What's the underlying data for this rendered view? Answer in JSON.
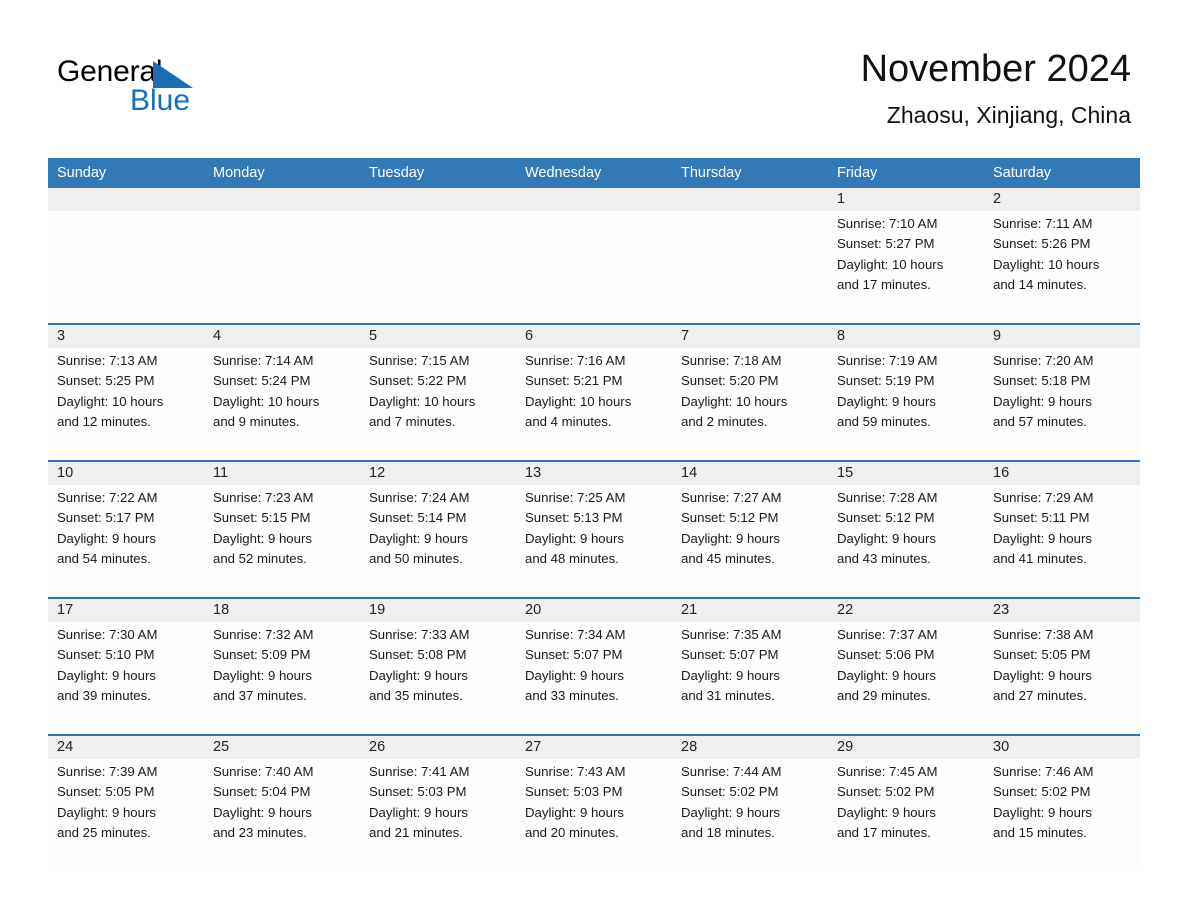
{
  "brand": {
    "name_part1": "General",
    "name_part2": "Blue",
    "triangle_color": "#1b6eb3",
    "blue_text_color": "#1570bd"
  },
  "header": {
    "month_title": "November 2024",
    "location": "Zhaosu, Xinjiang, China"
  },
  "theme": {
    "header_blue": "#3279b8",
    "row_divider_blue": "#2f74b5",
    "date_band_gray": "#efefef",
    "cell_background": "#fdfdfc",
    "page_background": "#ffffff"
  },
  "calendar": {
    "weekday_headers": [
      "Sunday",
      "Monday",
      "Tuesday",
      "Wednesday",
      "Thursday",
      "Friday",
      "Saturday"
    ],
    "weeks": [
      [
        {
          "day": "",
          "sunrise": "",
          "sunset": "",
          "daylight_line1": "",
          "daylight_line2": ""
        },
        {
          "day": "",
          "sunrise": "",
          "sunset": "",
          "daylight_line1": "",
          "daylight_line2": ""
        },
        {
          "day": "",
          "sunrise": "",
          "sunset": "",
          "daylight_line1": "",
          "daylight_line2": ""
        },
        {
          "day": "",
          "sunrise": "",
          "sunset": "",
          "daylight_line1": "",
          "daylight_line2": ""
        },
        {
          "day": "",
          "sunrise": "",
          "sunset": "",
          "daylight_line1": "",
          "daylight_line2": ""
        },
        {
          "day": "1",
          "sunrise": "Sunrise: 7:10 AM",
          "sunset": "Sunset: 5:27 PM",
          "daylight_line1": "Daylight: 10 hours",
          "daylight_line2": "and 17 minutes."
        },
        {
          "day": "2",
          "sunrise": "Sunrise: 7:11 AM",
          "sunset": "Sunset: 5:26 PM",
          "daylight_line1": "Daylight: 10 hours",
          "daylight_line2": "and 14 minutes."
        }
      ],
      [
        {
          "day": "3",
          "sunrise": "Sunrise: 7:13 AM",
          "sunset": "Sunset: 5:25 PM",
          "daylight_line1": "Daylight: 10 hours",
          "daylight_line2": "and 12 minutes."
        },
        {
          "day": "4",
          "sunrise": "Sunrise: 7:14 AM",
          "sunset": "Sunset: 5:24 PM",
          "daylight_line1": "Daylight: 10 hours",
          "daylight_line2": "and 9 minutes."
        },
        {
          "day": "5",
          "sunrise": "Sunrise: 7:15 AM",
          "sunset": "Sunset: 5:22 PM",
          "daylight_line1": "Daylight: 10 hours",
          "daylight_line2": "and 7 minutes."
        },
        {
          "day": "6",
          "sunrise": "Sunrise: 7:16 AM",
          "sunset": "Sunset: 5:21 PM",
          "daylight_line1": "Daylight: 10 hours",
          "daylight_line2": "and 4 minutes."
        },
        {
          "day": "7",
          "sunrise": "Sunrise: 7:18 AM",
          "sunset": "Sunset: 5:20 PM",
          "daylight_line1": "Daylight: 10 hours",
          "daylight_line2": "and 2 minutes."
        },
        {
          "day": "8",
          "sunrise": "Sunrise: 7:19 AM",
          "sunset": "Sunset: 5:19 PM",
          "daylight_line1": "Daylight: 9 hours",
          "daylight_line2": "and 59 minutes."
        },
        {
          "day": "9",
          "sunrise": "Sunrise: 7:20 AM",
          "sunset": "Sunset: 5:18 PM",
          "daylight_line1": "Daylight: 9 hours",
          "daylight_line2": "and 57 minutes."
        }
      ],
      [
        {
          "day": "10",
          "sunrise": "Sunrise: 7:22 AM",
          "sunset": "Sunset: 5:17 PM",
          "daylight_line1": "Daylight: 9 hours",
          "daylight_line2": "and 54 minutes."
        },
        {
          "day": "11",
          "sunrise": "Sunrise: 7:23 AM",
          "sunset": "Sunset: 5:15 PM",
          "daylight_line1": "Daylight: 9 hours",
          "daylight_line2": "and 52 minutes."
        },
        {
          "day": "12",
          "sunrise": "Sunrise: 7:24 AM",
          "sunset": "Sunset: 5:14 PM",
          "daylight_line1": "Daylight: 9 hours",
          "daylight_line2": "and 50 minutes."
        },
        {
          "day": "13",
          "sunrise": "Sunrise: 7:25 AM",
          "sunset": "Sunset: 5:13 PM",
          "daylight_line1": "Daylight: 9 hours",
          "daylight_line2": "and 48 minutes."
        },
        {
          "day": "14",
          "sunrise": "Sunrise: 7:27 AM",
          "sunset": "Sunset: 5:12 PM",
          "daylight_line1": "Daylight: 9 hours",
          "daylight_line2": "and 45 minutes."
        },
        {
          "day": "15",
          "sunrise": "Sunrise: 7:28 AM",
          "sunset": "Sunset: 5:12 PM",
          "daylight_line1": "Daylight: 9 hours",
          "daylight_line2": "and 43 minutes."
        },
        {
          "day": "16",
          "sunrise": "Sunrise: 7:29 AM",
          "sunset": "Sunset: 5:11 PM",
          "daylight_line1": "Daylight: 9 hours",
          "daylight_line2": "and 41 minutes."
        }
      ],
      [
        {
          "day": "17",
          "sunrise": "Sunrise: 7:30 AM",
          "sunset": "Sunset: 5:10 PM",
          "daylight_line1": "Daylight: 9 hours",
          "daylight_line2": "and 39 minutes."
        },
        {
          "day": "18",
          "sunrise": "Sunrise: 7:32 AM",
          "sunset": "Sunset: 5:09 PM",
          "daylight_line1": "Daylight: 9 hours",
          "daylight_line2": "and 37 minutes."
        },
        {
          "day": "19",
          "sunrise": "Sunrise: 7:33 AM",
          "sunset": "Sunset: 5:08 PM",
          "daylight_line1": "Daylight: 9 hours",
          "daylight_line2": "and 35 minutes."
        },
        {
          "day": "20",
          "sunrise": "Sunrise: 7:34 AM",
          "sunset": "Sunset: 5:07 PM",
          "daylight_line1": "Daylight: 9 hours",
          "daylight_line2": "and 33 minutes."
        },
        {
          "day": "21",
          "sunrise": "Sunrise: 7:35 AM",
          "sunset": "Sunset: 5:07 PM",
          "daylight_line1": "Daylight: 9 hours",
          "daylight_line2": "and 31 minutes."
        },
        {
          "day": "22",
          "sunrise": "Sunrise: 7:37 AM",
          "sunset": "Sunset: 5:06 PM",
          "daylight_line1": "Daylight: 9 hours",
          "daylight_line2": "and 29 minutes."
        },
        {
          "day": "23",
          "sunrise": "Sunrise: 7:38 AM",
          "sunset": "Sunset: 5:05 PM",
          "daylight_line1": "Daylight: 9 hours",
          "daylight_line2": "and 27 minutes."
        }
      ],
      [
        {
          "day": "24",
          "sunrise": "Sunrise: 7:39 AM",
          "sunset": "Sunset: 5:05 PM",
          "daylight_line1": "Daylight: 9 hours",
          "daylight_line2": "and 25 minutes."
        },
        {
          "day": "25",
          "sunrise": "Sunrise: 7:40 AM",
          "sunset": "Sunset: 5:04 PM",
          "daylight_line1": "Daylight: 9 hours",
          "daylight_line2": "and 23 minutes."
        },
        {
          "day": "26",
          "sunrise": "Sunrise: 7:41 AM",
          "sunset": "Sunset: 5:03 PM",
          "daylight_line1": "Daylight: 9 hours",
          "daylight_line2": "and 21 minutes."
        },
        {
          "day": "27",
          "sunrise": "Sunrise: 7:43 AM",
          "sunset": "Sunset: 5:03 PM",
          "daylight_line1": "Daylight: 9 hours",
          "daylight_line2": "and 20 minutes."
        },
        {
          "day": "28",
          "sunrise": "Sunrise: 7:44 AM",
          "sunset": "Sunset: 5:02 PM",
          "daylight_line1": "Daylight: 9 hours",
          "daylight_line2": "and 18 minutes."
        },
        {
          "day": "29",
          "sunrise": "Sunrise: 7:45 AM",
          "sunset": "Sunset: 5:02 PM",
          "daylight_line1": "Daylight: 9 hours",
          "daylight_line2": "and 17 minutes."
        },
        {
          "day": "30",
          "sunrise": "Sunrise: 7:46 AM",
          "sunset": "Sunset: 5:02 PM",
          "daylight_line1": "Daylight: 9 hours",
          "daylight_line2": "and 15 minutes."
        }
      ]
    ]
  }
}
